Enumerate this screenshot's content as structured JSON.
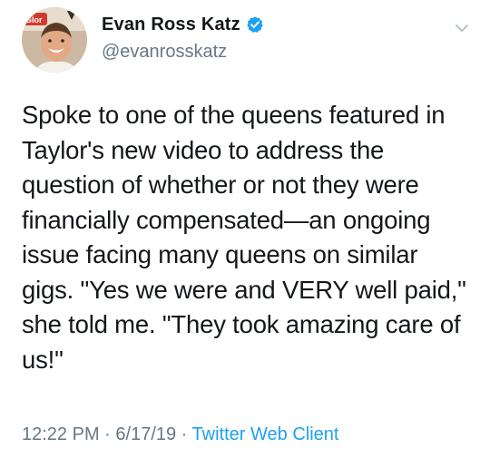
{
  "tweet": {
    "display_name": "Evan Ross Katz",
    "handle": "@evanrosskatz",
    "avatar_sign_text": "Glor",
    "body_lines": [
      "Spoke to one of the queens featured in",
      "Taylor's new video to address the",
      "question of whether or not they were",
      "financially compensated—an ongoing",
      "issue facing many queens on similar",
      "gigs. \"Yes we were and VERY well paid,\"",
      "she told me. \"They took amazing care of",
      "us!\""
    ],
    "time": "12:22 PM",
    "separator": " · ",
    "date": "6/17/19",
    "source": "Twitter Web Client"
  },
  "colors": {
    "verified_blue": "#1da1f2",
    "secondary_text": "#657786",
    "link": "#1da1f2",
    "primary_text": "#14171a"
  },
  "icons": {
    "verified": "verified-badge-icon",
    "menu": "chevron-down-icon"
  }
}
